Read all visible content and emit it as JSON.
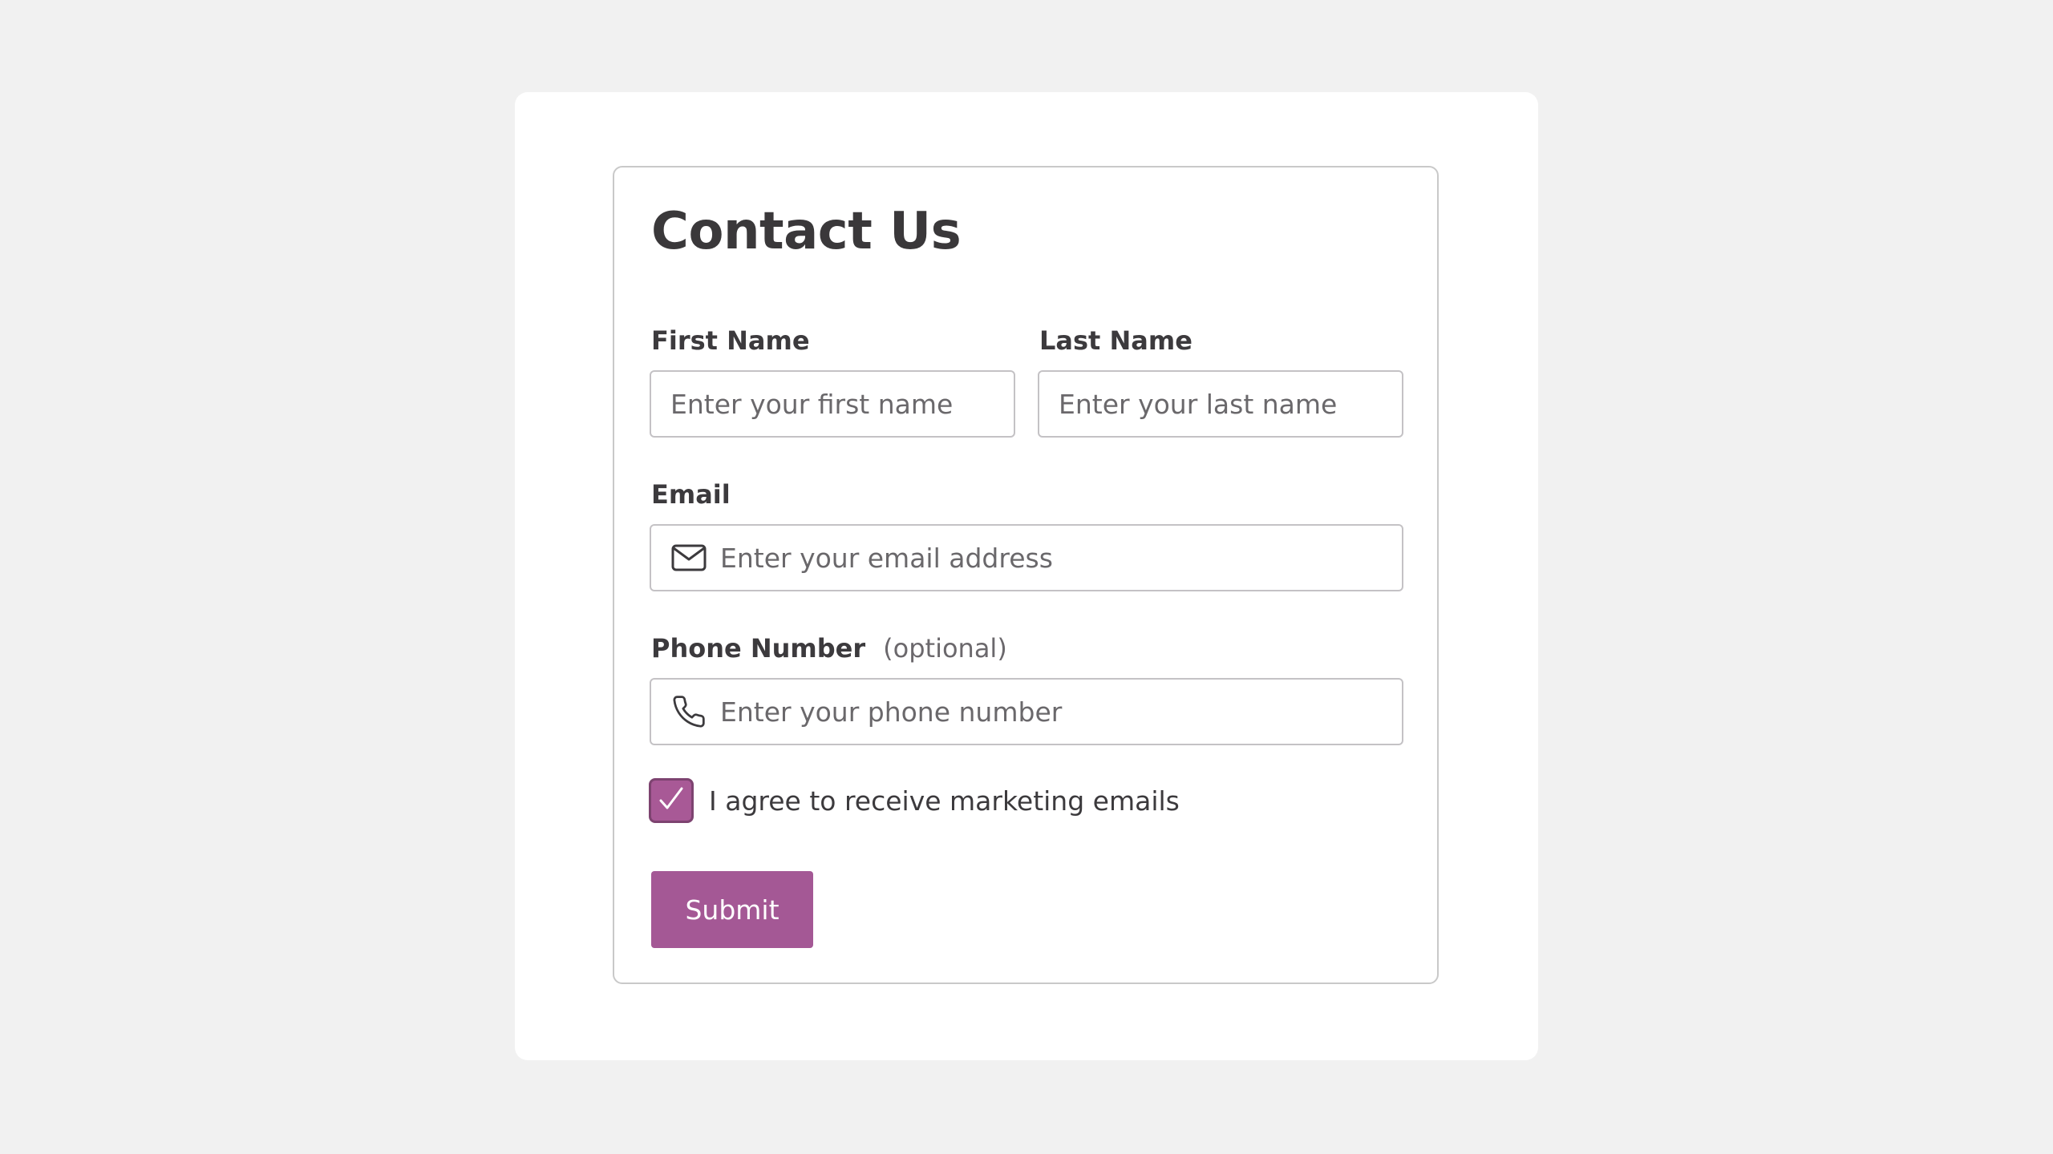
{
  "form": {
    "title": "Contact Us",
    "first_name": {
      "label": "First Name",
      "placeholder": "Enter your first name",
      "value": ""
    },
    "last_name": {
      "label": "Last Name",
      "placeholder": "Enter your last name",
      "value": ""
    },
    "email": {
      "label": "Email",
      "placeholder": "Enter your email address",
      "value": "",
      "icon": "envelope-icon"
    },
    "phone": {
      "label": "Phone Number",
      "optional_note": "(optional)",
      "placeholder": "Enter your phone number",
      "value": "",
      "icon": "phone-icon"
    },
    "marketing_consent": {
      "label": "I agree to receive marketing emails",
      "checked": true,
      "icon": "checkmark-icon"
    },
    "submit_label": "Submit"
  },
  "colors": {
    "page_background": "#f1f1f1",
    "panel_background": "#ffffff",
    "accent": "#a45895",
    "text": "#3c3a3d",
    "placeholder": "#6a686b",
    "border": "#c4c2c5"
  }
}
